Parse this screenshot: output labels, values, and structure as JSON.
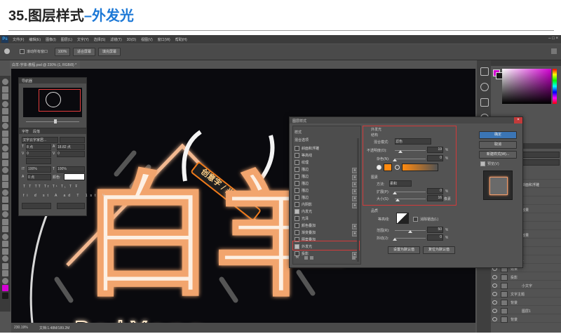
{
  "caption": {
    "number": "35.",
    "title": "图层样式",
    "dash": "–",
    "highlight": "外发光"
  },
  "menu": [
    "文件(F)",
    "编辑(E)",
    "图像(I)",
    "图层(L)",
    "文字(Y)",
    "选择(S)",
    "滤镜(T)",
    "3D(D)",
    "视图(V)",
    "窗口(W)",
    "帮助(H)"
  ],
  "options": {
    "check_label": "滚动所有窗口",
    "zoom": "100%",
    "fit_screen": "适合屏幕",
    "fill_screen": "填充屏幕"
  },
  "doc_tab": "白羊-字体-教程.psd @ 230% (1, RGB/8) *",
  "status": {
    "zoom": "230.19%",
    "doc": "文档:1.48M/189.2M"
  },
  "navigator": {
    "title": "导航器"
  },
  "character": {
    "tabs": [
      "字符",
      "段落"
    ],
    "font_family": "汉字云字家居...",
    "font_size": "8 点",
    "leading": "18.82 点",
    "kerning": "0",
    "tracking": "0",
    "scale_v": "100%",
    "scale_h": "100%",
    "baseline": "0 点",
    "color_label": "颜色:",
    "style_buttons": [
      "T",
      "T",
      "TT",
      "Tr",
      "T¹",
      "T₁",
      "T",
      "Ŧ"
    ]
  },
  "artwork": {
    "main": "白羊",
    "badge": "创意字 / 光效果",
    "sub": "BaiYang"
  },
  "dialog": {
    "title": "图层样式",
    "close": "×",
    "style_header": "样式",
    "blend_options": "混合选项",
    "styles": [
      {
        "label": "斜面和浮雕",
        "checked": false,
        "plus": false
      },
      {
        "label": "等高线",
        "checked": false,
        "plus": false
      },
      {
        "label": "纹理",
        "checked": false,
        "plus": false
      },
      {
        "label": "描边",
        "checked": false,
        "plus": true
      },
      {
        "label": "描边",
        "checked": false,
        "plus": true
      },
      {
        "label": "描边",
        "checked": false,
        "plus": true
      },
      {
        "label": "描边",
        "checked": false,
        "plus": true
      },
      {
        "label": "描边",
        "checked": false,
        "plus": true
      },
      {
        "label": "内阴影",
        "checked": false,
        "plus": true
      },
      {
        "label": "内发光",
        "checked": true,
        "plus": false
      },
      {
        "label": "光泽",
        "checked": false,
        "plus": false
      },
      {
        "label": "颜色叠加",
        "checked": false,
        "plus": true
      },
      {
        "label": "渐变叠加",
        "checked": false,
        "plus": true
      },
      {
        "label": "图案叠加",
        "checked": false,
        "plus": false
      },
      {
        "label": "外发光",
        "checked": true,
        "plus": false
      },
      {
        "label": "投影",
        "checked": false,
        "plus": true
      }
    ],
    "fx_label": "fx",
    "outer_glow": {
      "section_title": "外发光",
      "structure": "结构",
      "blend_mode_label": "混合模式:",
      "blend_mode": "滤色",
      "opacity_label": "不透明度(O):",
      "opacity": "19",
      "opacity_fraction": 0.19,
      "noise_label": "杂色(N):",
      "noise": "0",
      "noise_fraction": 0,
      "pct": "%",
      "glow_color": "#ff8a10",
      "elements": "图素",
      "technique_label": "方法:",
      "technique": "柔和",
      "spread_label": "扩展(P):",
      "spread": "0",
      "spread_fraction": 0,
      "size_label": "大小(S):",
      "size": "16",
      "size_fraction": 0.1,
      "px": "像素",
      "quality": "品质",
      "contour_label": "等高线:",
      "antialias": "消除锯齿(L)",
      "range_label": "范围(R):",
      "range": "50",
      "range_fraction": 0.5,
      "jitter_label": "抖动(J):",
      "jitter": "0",
      "jitter_fraction": 0,
      "set_default": "设置为默认值",
      "reset_default": "复位为默认值"
    },
    "buttons": {
      "ok": "确定",
      "cancel": "取消",
      "new_style": "新建样式(W)...",
      "preview": "预览(V)"
    }
  },
  "layers": {
    "labels": [
      "图层 7",
      "斜面和浮雕",
      "图层 1",
      "光效",
      "效果",
      "内发光",
      "外发光",
      "效果",
      "内发光",
      "外发光",
      "1",
      "效果",
      "投影",
      "小文字",
      "文字主题",
      "背景",
      "图层1",
      "背景"
    ]
  },
  "colors": {
    "accent": "#1c78d6",
    "redbox": "#d23a3a",
    "glow": "#f5c9a2"
  }
}
